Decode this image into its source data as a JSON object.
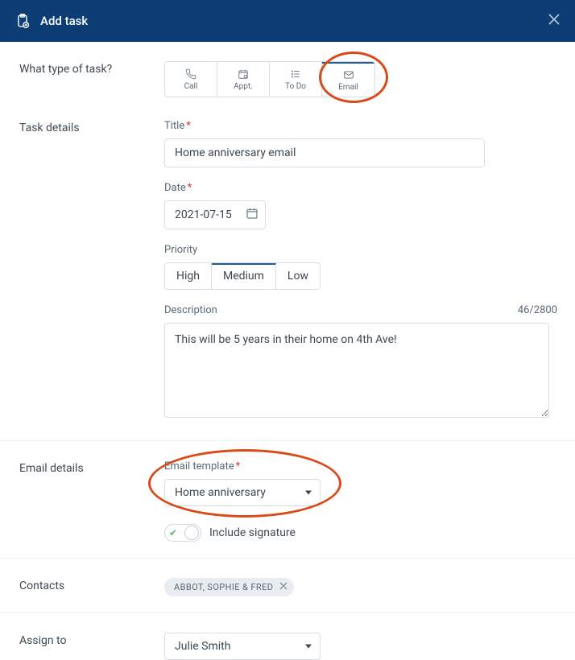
{
  "header": {
    "title": "Add task"
  },
  "taskType": {
    "label": "What type of task?",
    "options": [
      "Call",
      "Appt.",
      "To Do",
      "Email"
    ],
    "selected": "Email"
  },
  "details": {
    "section_label": "Task details",
    "title_label": "Title",
    "title_value": "Home anniversary email",
    "date_label": "Date",
    "date_value": "2021-07-15",
    "priority_label": "Priority",
    "priority_options": [
      "High",
      "Medium",
      "Low"
    ],
    "priority_selected": "Medium",
    "desc_label": "Description",
    "desc_value": "This will be 5 years in their home on 4th Ave!",
    "desc_count": "46/2800"
  },
  "emailDetails": {
    "section_label": "Email details",
    "template_label": "Email template",
    "template_value": "Home anniversary",
    "signature_label": "Include signature"
  },
  "contacts": {
    "section_label": "Contacts",
    "chips": [
      "ABBOT, SOPHIE & FRED"
    ]
  },
  "assign": {
    "section_label": "Assign to",
    "value": "Julie Smith"
  }
}
